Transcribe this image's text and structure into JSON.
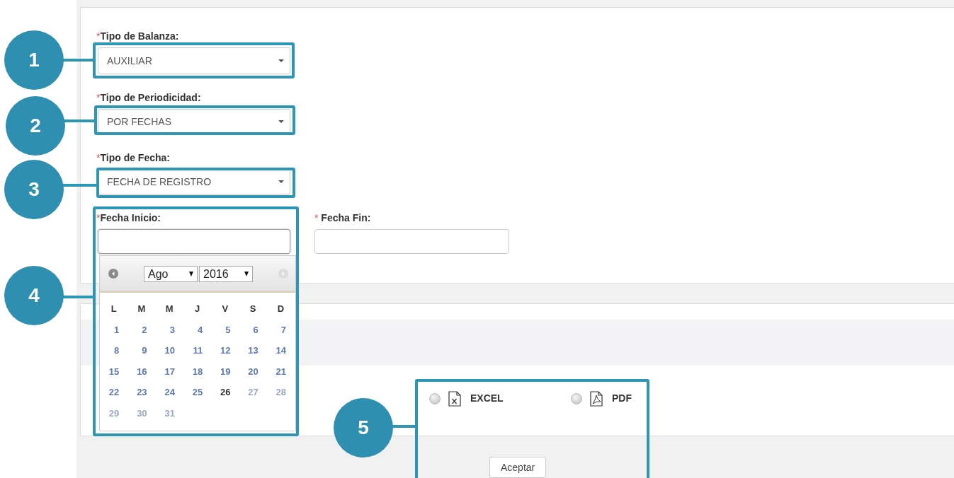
{
  "form": {
    "selects": [
      {
        "label": "Tipo de Balanza:",
        "required_mark": "*",
        "value": "AUXILIAR"
      },
      {
        "label": "Tipo de Periodicidad:",
        "required_mark": "*",
        "value": "POR FECHAS"
      },
      {
        "label": "Tipo de Fecha:",
        "required_mark": "*",
        "value": "FECHA DE REGISTRO"
      }
    ],
    "date_fields": [
      {
        "label": "Fecha Inicio:",
        "required_mark": "*",
        "calendar_open": true
      },
      {
        "label": " Fecha Fin:",
        "required_mark": "*",
        "calendar_open": false
      }
    ]
  },
  "calendar": {
    "month": "Ago",
    "year": "2016",
    "weekdays": [
      "L",
      "M",
      "M",
      "J",
      "V",
      "S",
      "D"
    ],
    "days": [
      {
        "label": "1",
        "today": false,
        "disabled": false
      },
      {
        "label": "2",
        "today": false,
        "disabled": false
      },
      {
        "label": "3",
        "today": false,
        "disabled": false
      },
      {
        "label": "4",
        "today": false,
        "disabled": false
      },
      {
        "label": "5",
        "today": false,
        "disabled": false
      },
      {
        "label": "6",
        "today": false,
        "disabled": false
      },
      {
        "label": "7",
        "today": false,
        "disabled": false
      },
      {
        "label": "8",
        "today": false,
        "disabled": false
      },
      {
        "label": "9",
        "today": false,
        "disabled": false
      },
      {
        "label": "10",
        "today": false,
        "disabled": false
      },
      {
        "label": "11",
        "today": false,
        "disabled": false
      },
      {
        "label": "12",
        "today": false,
        "disabled": false
      },
      {
        "label": "13",
        "today": false,
        "disabled": false
      },
      {
        "label": "14",
        "today": false,
        "disabled": false
      },
      {
        "label": "15",
        "today": false,
        "disabled": false
      },
      {
        "label": "16",
        "today": false,
        "disabled": false
      },
      {
        "label": "17",
        "today": false,
        "disabled": false
      },
      {
        "label": "18",
        "today": false,
        "disabled": false
      },
      {
        "label": "19",
        "today": false,
        "disabled": false
      },
      {
        "label": "20",
        "today": false,
        "disabled": false
      },
      {
        "label": "21",
        "today": false,
        "disabled": false
      },
      {
        "label": "22",
        "today": false,
        "disabled": false
      },
      {
        "label": "23",
        "today": false,
        "disabled": false
      },
      {
        "label": "24",
        "today": false,
        "disabled": false
      },
      {
        "label": "25",
        "today": false,
        "disabled": false
      },
      {
        "label": "26",
        "today": true,
        "disabled": false
      },
      {
        "label": "27",
        "today": false,
        "disabled": true
      },
      {
        "label": "28",
        "today": false,
        "disabled": true
      },
      {
        "label": "29",
        "today": false,
        "disabled": true
      },
      {
        "label": "30",
        "today": false,
        "disabled": true
      },
      {
        "label": "31",
        "today": false,
        "disabled": true
      }
    ]
  },
  "formats": [
    {
      "kind": "excel",
      "label": "EXCEL",
      "selected": false
    },
    {
      "kind": "pdf",
      "label": "PDF",
      "selected": false
    }
  ],
  "submit": "Aceptar",
  "callouts": [
    {
      "number": "1"
    },
    {
      "number": "2"
    },
    {
      "number": "3"
    },
    {
      "number": "4"
    },
    {
      "number": "5"
    }
  ]
}
